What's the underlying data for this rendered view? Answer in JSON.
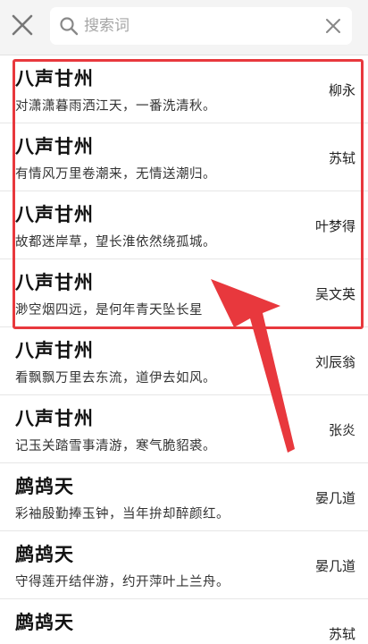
{
  "search": {
    "placeholder": "搜索词",
    "value": ""
  },
  "results": [
    {
      "title": "八声甘州",
      "line": "对潇潇暮雨洒江天，一番洗清秋。",
      "author": "柳永"
    },
    {
      "title": "八声甘州",
      "line": "有情风万里卷潮来，无情送潮归。",
      "author": "苏轼"
    },
    {
      "title": "八声甘州",
      "line": "故都迷岸草，望长淮依然绕孤城。",
      "author": "叶梦得"
    },
    {
      "title": "八声甘州",
      "line": "渺空烟四远，是何年青天坠长星",
      "author": "吴文英"
    },
    {
      "title": "八声甘州",
      "line": "看飘飘万里去东流，道伊去如风。",
      "author": "刘辰翁"
    },
    {
      "title": "八声甘州",
      "line": "记玉关踏雪事清游，寒气脆貂裘。",
      "author": "张炎"
    },
    {
      "title": "鹧鸪天",
      "line": "彩袖殷勤捧玉钟，当年拚却醉颜红。",
      "author": "晏几道"
    },
    {
      "title": "鹧鸪天",
      "line": "守得莲开结伴游，约开萍叶上兰舟。",
      "author": "晏几道"
    },
    {
      "title": "鹧鸪天",
      "line": "",
      "author": "苏轼"
    }
  ],
  "colors": {
    "highlight": "#e8383d",
    "header_bg": "#f4f4f4"
  }
}
